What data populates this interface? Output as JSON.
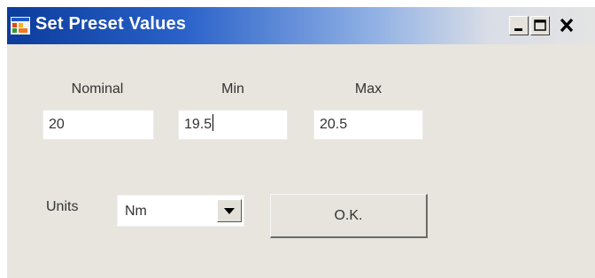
{
  "window": {
    "title": "Set Preset Values",
    "title_icon": "app-form-icon",
    "controls": {
      "minimize_icon": "minimize-icon",
      "maximize_icon": "maximize-icon",
      "close_icon": "close-icon"
    }
  },
  "form": {
    "nominal": {
      "label": "Nominal",
      "value": "20"
    },
    "min": {
      "label": "Min",
      "value": "19.5"
    },
    "max": {
      "label": "Max",
      "value": "20.5"
    },
    "units": {
      "label": "Units",
      "selected": "Nm",
      "dropdown_icon": "chevron-down-icon"
    },
    "ok_label": "O.K."
  },
  "colors": {
    "titlebar_start": "#0b3c9c",
    "titlebar_end": "#e4e4e4",
    "window_background": "#e7e5dd"
  }
}
